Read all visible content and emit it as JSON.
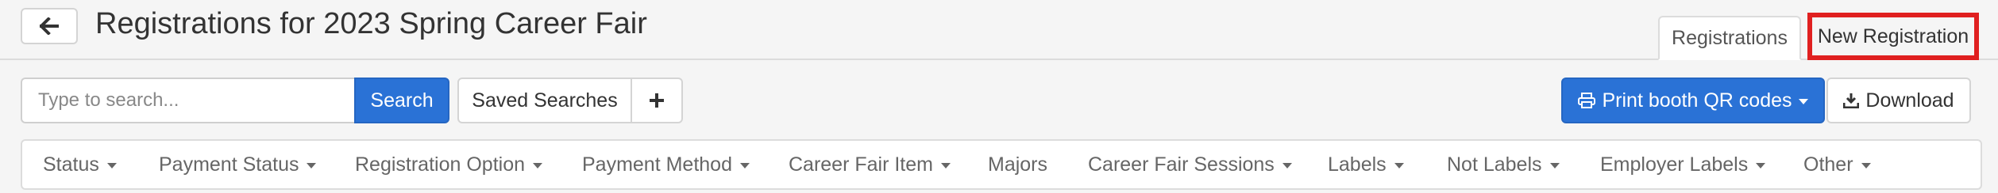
{
  "header": {
    "title": "Registrations for 2023 Spring Career Fair",
    "back_icon": "arrow-left-icon",
    "tabs": [
      {
        "label": "Registrations",
        "active": true
      },
      {
        "label": "New Registration",
        "active": false,
        "highlighted": true
      }
    ]
  },
  "toolbar": {
    "search_placeholder": "Type to search...",
    "search_label": "Search",
    "saved_searches_label": "Saved Searches",
    "add_icon": "plus-icon",
    "print_label": "Print booth QR codes",
    "print_icon": "printer-icon",
    "download_label": "Download",
    "download_icon": "download-icon"
  },
  "filters": [
    {
      "label": "Status",
      "dropdown": true
    },
    {
      "label": "Payment Status",
      "dropdown": true
    },
    {
      "label": "Registration Option",
      "dropdown": true
    },
    {
      "label": "Payment Method",
      "dropdown": true
    },
    {
      "label": "Career Fair Item",
      "dropdown": true
    },
    {
      "label": "Majors",
      "dropdown": false
    },
    {
      "label": "Career Fair Sessions",
      "dropdown": true
    },
    {
      "label": "Labels",
      "dropdown": true
    },
    {
      "label": "Not Labels",
      "dropdown": true
    },
    {
      "label": "Employer Labels",
      "dropdown": true
    },
    {
      "label": "Other",
      "dropdown": true
    }
  ],
  "colors": {
    "primary": "#2a72d6",
    "highlight_border": "#e02020",
    "background": "#f5f5f5"
  }
}
